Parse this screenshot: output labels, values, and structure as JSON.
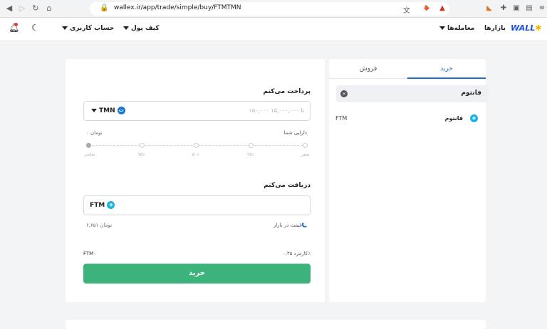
{
  "browser": {
    "url": "wallex.ir/app/trade/simple/buy/FTMTMN"
  },
  "header": {
    "logo": "WALL",
    "markets": "بازارها",
    "trades": "معامله‌ها",
    "wallet": "کیف پول",
    "account": "حساب کاربری"
  },
  "side": {
    "tab_buy": "خرید",
    "tab_sell": "فروش",
    "search_value": "فانتوم",
    "coin_name": "فانتوم",
    "coin_symbol": "FTM"
  },
  "trade": {
    "pay_title": "پرداخت می‌کنم",
    "pay_placeholder": "۱۵۰,۰۰۰ تا ۱۵,۰۰۰,۰۰۰",
    "pay_currency": "TMN",
    "balance_label": "دارایی شما",
    "balance_value": "۰ تومان",
    "slider_ticks": [
      "تمامی",
      "۷۵٪",
      "۵۰٪",
      "۲۵٪",
      "صفر"
    ],
    "receive_title": "دریافت می‌کنم",
    "receive_currency": "FTM",
    "market_price_label": "قیمت در بازار",
    "market_price_value": "۶,۶۵۱ تومان",
    "fee_label": "کارمزد ۰.۳۵٪",
    "fee_value": "FTM۰",
    "buy_button": "خرید"
  },
  "colors": {
    "accent_blue": "#1e6fd9",
    "buy_green": "#3bb37a"
  }
}
